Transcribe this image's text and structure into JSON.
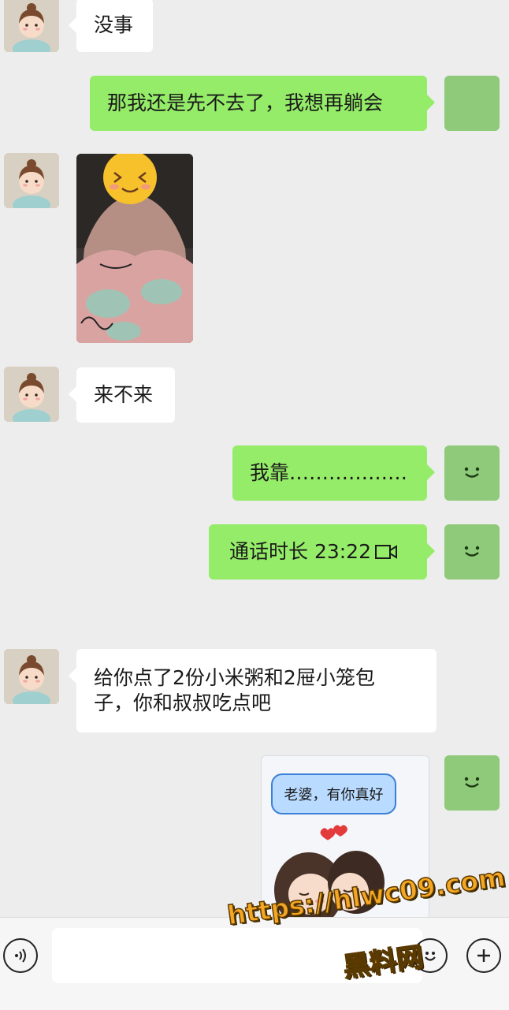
{
  "messages": [
    {
      "side": "left",
      "text": "没事"
    },
    {
      "side": "right",
      "text": "那我还是先不去了，我想再躺会"
    },
    {
      "side": "left",
      "type": "photo"
    },
    {
      "side": "left",
      "text": "来不来"
    },
    {
      "side": "right",
      "text": "我靠……………."
    },
    {
      "side": "right",
      "text": "通话时长 23:22",
      "icon": "video-call-icon"
    },
    {
      "side": "left",
      "text": "给你点了2份小米粥和2屉小笼包子，你和叔叔吃点吧"
    },
    {
      "side": "right",
      "type": "sticker",
      "sticker_text": "老婆，有你真好"
    }
  ],
  "msg_text_1": "没事",
  "msg_text_2": "那我还是先不去了，我想再躺会",
  "msg_text_4": "来不来",
  "msg_text_5": "我靠………………",
  "msg_text_6": "通话时长 23:22",
  "msg_text_7_line1": "给你点了2份小米粥和2屉小笼包",
  "msg_text_7_line2": "子，你和叔叔吃点吧",
  "sticker_text": "老婆，有你真好",
  "watermark": {
    "line1": "https://hlwc09.com",
    "line2": "黑料网"
  },
  "toolbar": {
    "voice_icon": "voice-icon",
    "emoji_icon": "emoji-icon",
    "plus_icon": "plus-icon"
  },
  "colors": {
    "background": "#ededed",
    "my_bubble": "#95ec69",
    "their_bubble": "#ffffff",
    "my_avatar": "#8fc97a"
  }
}
